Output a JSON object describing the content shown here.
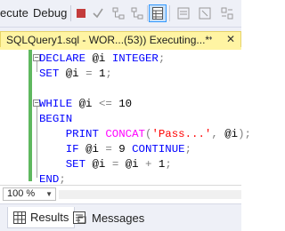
{
  "toolbar": {
    "execute_label": "ecute",
    "debug_label": "Debug",
    "icons": [
      "stop-icon",
      "parse-checkmark-icon",
      "display-plan-icon",
      "include-plan-icon",
      "results-to-grid-icon",
      "results-to-text-icon",
      "results-to-file-icon"
    ]
  },
  "tab": {
    "title": "SQLQuery1.sql - WOR...(53)) Executing...*",
    "pin": "⬪",
    "close": "✕"
  },
  "editor": {
    "lines": [
      {
        "tokens": [
          {
            "c": "kw",
            "t": "DECLARE "
          },
          {
            "c": "",
            "t": "@i "
          },
          {
            "c": "kw",
            "t": "INTEGER"
          },
          {
            "c": "pun",
            "t": ";"
          }
        ]
      },
      {
        "tokens": [
          {
            "c": "kw",
            "t": "SET "
          },
          {
            "c": "",
            "t": "@i "
          },
          {
            "c": "pun",
            "t": "= "
          },
          {
            "c": "",
            "t": "1"
          },
          {
            "c": "pun",
            "t": ";"
          }
        ]
      },
      {
        "tokens": []
      },
      {
        "tokens": [
          {
            "c": "kw",
            "t": "WHILE "
          },
          {
            "c": "",
            "t": "@i "
          },
          {
            "c": "pun",
            "t": "<= "
          },
          {
            "c": "",
            "t": "10"
          }
        ]
      },
      {
        "tokens": [
          {
            "c": "kw",
            "t": "BEGIN"
          }
        ]
      },
      {
        "tokens": [
          {
            "c": "",
            "t": "    "
          },
          {
            "c": "kw",
            "t": "PRINT "
          },
          {
            "c": "fn",
            "t": "CONCAT"
          },
          {
            "c": "pun",
            "t": "("
          },
          {
            "c": "str",
            "t": "'Pass...'"
          },
          {
            "c": "pun",
            "t": ", "
          },
          {
            "c": "",
            "t": "@i"
          },
          {
            "c": "pun",
            "t": ");"
          }
        ]
      },
      {
        "tokens": [
          {
            "c": "",
            "t": "    "
          },
          {
            "c": "kw",
            "t": "IF "
          },
          {
            "c": "",
            "t": "@i "
          },
          {
            "c": "pun",
            "t": "= "
          },
          {
            "c": "",
            "t": "9 "
          },
          {
            "c": "kw",
            "t": "CONTINUE"
          },
          {
            "c": "pun",
            "t": ";"
          }
        ]
      },
      {
        "tokens": [
          {
            "c": "",
            "t": "    "
          },
          {
            "c": "kw",
            "t": "SET "
          },
          {
            "c": "",
            "t": "@i "
          },
          {
            "c": "pun",
            "t": "= "
          },
          {
            "c": "",
            "t": "@i "
          },
          {
            "c": "pun",
            "t": "+ "
          },
          {
            "c": "",
            "t": "1"
          },
          {
            "c": "pun",
            "t": ";"
          }
        ]
      },
      {
        "tokens": [
          {
            "c": "kw",
            "t": "END"
          },
          {
            "c": "pun",
            "t": ";"
          }
        ]
      }
    ]
  },
  "status": {
    "zoom": "100 %"
  },
  "results": {
    "tabs": [
      {
        "label": "Results",
        "icon": "grid-icon",
        "selected": true
      },
      {
        "label": "Messages",
        "icon": "messages-icon",
        "selected": false
      }
    ]
  },
  "colors": {
    "keyword": "#0000ff",
    "function": "#ff00ff",
    "string": "#ff0000",
    "operator": "#808080",
    "tab_executing": "#fff4a3",
    "change_bar": "#5fb85f"
  }
}
